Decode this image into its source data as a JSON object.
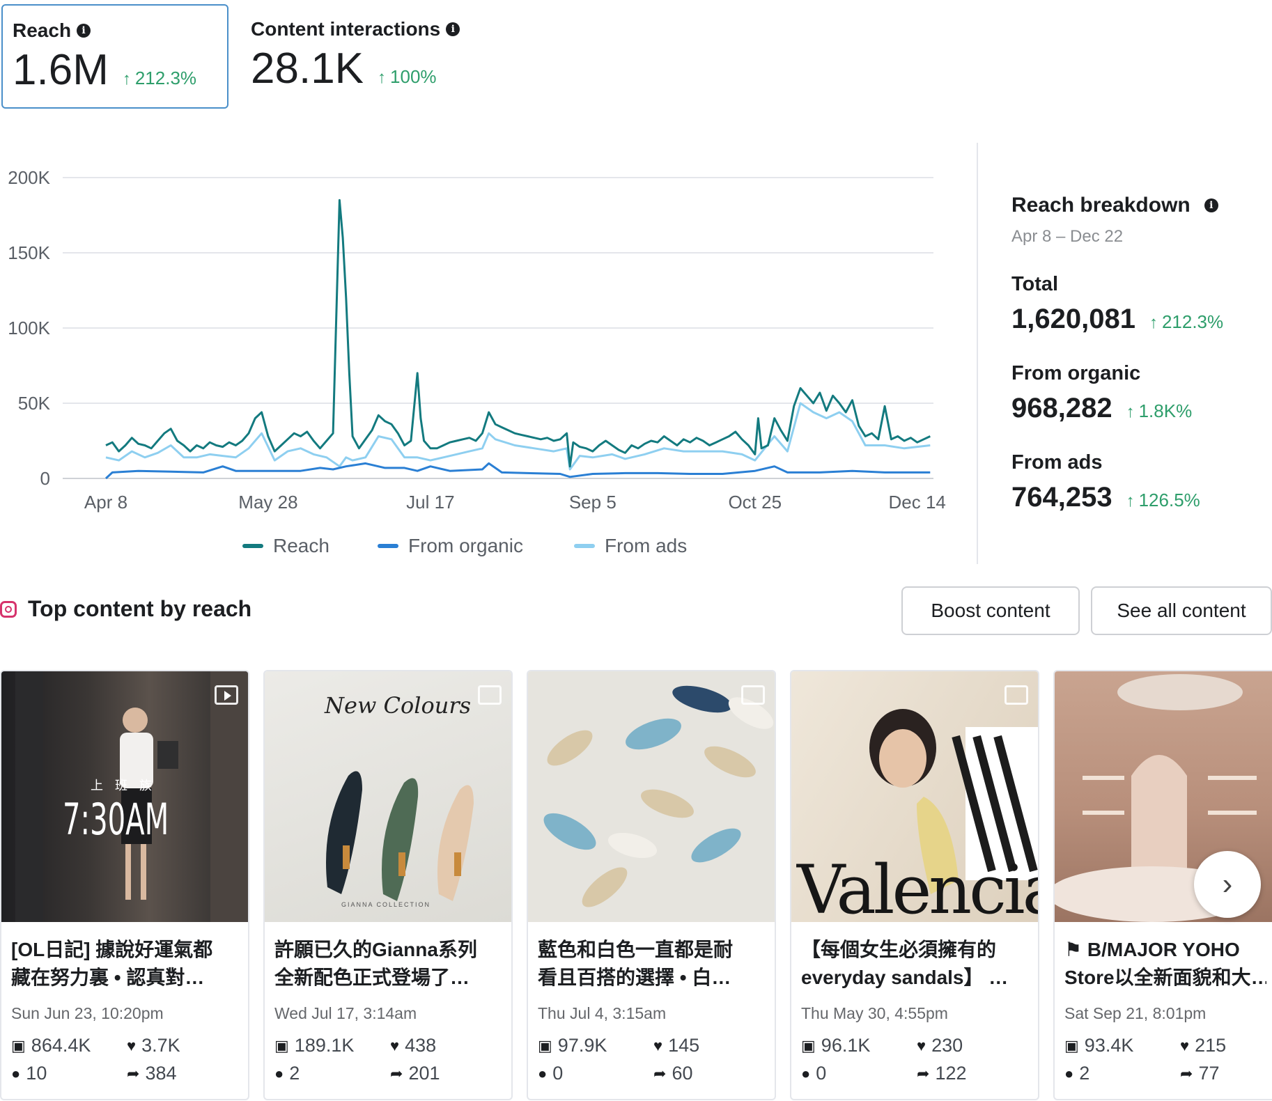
{
  "metrics": {
    "reach": {
      "label": "Reach",
      "value": "1.6M",
      "change": "212.3%"
    },
    "interactions": {
      "label": "Content interactions",
      "value": "28.1K",
      "change": "100%"
    }
  },
  "chart_data": {
    "type": "line",
    "x_ticks": [
      "Apr 8",
      "May 28",
      "Jul 17",
      "Sep 5",
      "Oct 25",
      "Dec 14"
    ],
    "y_ticks": [
      "200K",
      "150K",
      "100K",
      "50K",
      "0"
    ],
    "ylim": [
      0,
      200000
    ],
    "grid": true,
    "legend_position": "bottom",
    "x_range_days": 255,
    "series": [
      {
        "name": "Reach",
        "color": "#137a7f",
        "values": [
          [
            0,
            22000
          ],
          [
            2,
            24000
          ],
          [
            4,
            18000
          ],
          [
            6,
            22000
          ],
          [
            8,
            27000
          ],
          [
            10,
            23000
          ],
          [
            12,
            22000
          ],
          [
            14,
            20000
          ],
          [
            16,
            25000
          ],
          [
            18,
            30000
          ],
          [
            20,
            33000
          ],
          [
            22,
            25000
          ],
          [
            24,
            22000
          ],
          [
            26,
            18000
          ],
          [
            28,
            22000
          ],
          [
            30,
            20000
          ],
          [
            32,
            24000
          ],
          [
            34,
            22000
          ],
          [
            36,
            21000
          ],
          [
            38,
            24000
          ],
          [
            40,
            22000
          ],
          [
            42,
            25000
          ],
          [
            44,
            30000
          ],
          [
            46,
            40000
          ],
          [
            48,
            44000
          ],
          [
            50,
            28000
          ],
          [
            52,
            18000
          ],
          [
            54,
            22000
          ],
          [
            56,
            26000
          ],
          [
            58,
            30000
          ],
          [
            60,
            28000
          ],
          [
            62,
            31000
          ],
          [
            64,
            25000
          ],
          [
            66,
            20000
          ],
          [
            68,
            25000
          ],
          [
            70,
            30000
          ],
          [
            72,
            185000
          ],
          [
            73,
            160000
          ],
          [
            74,
            120000
          ],
          [
            75,
            70000
          ],
          [
            76,
            28000
          ],
          [
            78,
            20000
          ],
          [
            80,
            26000
          ],
          [
            82,
            32000
          ],
          [
            84,
            42000
          ],
          [
            86,
            38000
          ],
          [
            88,
            36000
          ],
          [
            90,
            30000
          ],
          [
            92,
            22000
          ],
          [
            94,
            25000
          ],
          [
            96,
            70000
          ],
          [
            97,
            40000
          ],
          [
            98,
            25000
          ],
          [
            100,
            20000
          ],
          [
            102,
            20000
          ],
          [
            104,
            22000
          ],
          [
            106,
            24000
          ],
          [
            108,
            25000
          ],
          [
            110,
            26000
          ],
          [
            112,
            27000
          ],
          [
            114,
            25000
          ],
          [
            116,
            30000
          ],
          [
            118,
            44000
          ],
          [
            120,
            36000
          ],
          [
            122,
            34000
          ],
          [
            124,
            32000
          ],
          [
            126,
            30000
          ],
          [
            128,
            29000
          ],
          [
            130,
            28000
          ],
          [
            132,
            27000
          ],
          [
            134,
            26000
          ],
          [
            136,
            27000
          ],
          [
            138,
            25000
          ],
          [
            140,
            26000
          ],
          [
            142,
            30000
          ],
          [
            143,
            8000
          ],
          [
            144,
            24000
          ],
          [
            146,
            21000
          ],
          [
            148,
            20000
          ],
          [
            150,
            18000
          ],
          [
            152,
            22000
          ],
          [
            154,
            25000
          ],
          [
            156,
            22000
          ],
          [
            158,
            19000
          ],
          [
            160,
            17000
          ],
          [
            162,
            22000
          ],
          [
            164,
            20000
          ],
          [
            166,
            23000
          ],
          [
            168,
            25000
          ],
          [
            170,
            24000
          ],
          [
            172,
            28000
          ],
          [
            174,
            25000
          ],
          [
            176,
            22000
          ],
          [
            178,
            26000
          ],
          [
            180,
            24000
          ],
          [
            182,
            27000
          ],
          [
            184,
            25000
          ],
          [
            186,
            22000
          ],
          [
            188,
            24000
          ],
          [
            190,
            26000
          ],
          [
            192,
            28000
          ],
          [
            194,
            31000
          ],
          [
            196,
            26000
          ],
          [
            198,
            22000
          ],
          [
            200,
            16000
          ],
          [
            201,
            40000
          ],
          [
            202,
            20000
          ],
          [
            204,
            22000
          ],
          [
            206,
            40000
          ],
          [
            208,
            32000
          ],
          [
            210,
            25000
          ],
          [
            212,
            48000
          ],
          [
            214,
            60000
          ],
          [
            216,
            55000
          ],
          [
            218,
            50000
          ],
          [
            220,
            57000
          ],
          [
            222,
            45000
          ],
          [
            224,
            55000
          ],
          [
            226,
            50000
          ],
          [
            228,
            44000
          ],
          [
            230,
            52000
          ],
          [
            232,
            35000
          ],
          [
            234,
            28000
          ],
          [
            236,
            30000
          ],
          [
            238,
            26000
          ],
          [
            240,
            48000
          ],
          [
            242,
            26000
          ],
          [
            244,
            28000
          ],
          [
            246,
            25000
          ],
          [
            248,
            27000
          ],
          [
            250,
            24000
          ],
          [
            252,
            26000
          ],
          [
            254,
            28000
          ]
        ]
      },
      {
        "name": "From organic",
        "color": "#2a7fd4",
        "values": [
          [
            0,
            0
          ],
          [
            2,
            4000
          ],
          [
            10,
            5000
          ],
          [
            20,
            4500
          ],
          [
            30,
            4000
          ],
          [
            36,
            8000
          ],
          [
            40,
            5000
          ],
          [
            50,
            5000
          ],
          [
            60,
            5000
          ],
          [
            66,
            7000
          ],
          [
            70,
            6000
          ],
          [
            74,
            8000
          ],
          [
            80,
            10000
          ],
          [
            86,
            7000
          ],
          [
            92,
            7000
          ],
          [
            96,
            5000
          ],
          [
            100,
            8000
          ],
          [
            106,
            5000
          ],
          [
            116,
            6000
          ],
          [
            118,
            10000
          ],
          [
            122,
            4000
          ],
          [
            130,
            3500
          ],
          [
            140,
            3000
          ],
          [
            143,
            1000
          ],
          [
            150,
            3000
          ],
          [
            160,
            3500
          ],
          [
            170,
            3500
          ],
          [
            180,
            3000
          ],
          [
            190,
            3000
          ],
          [
            200,
            5000
          ],
          [
            206,
            8000
          ],
          [
            210,
            4000
          ],
          [
            220,
            4000
          ],
          [
            230,
            5000
          ],
          [
            240,
            4000
          ],
          [
            254,
            4000
          ]
        ]
      },
      {
        "name": "From ads",
        "color": "#8ecff0",
        "values": [
          [
            0,
            14000
          ],
          [
            4,
            12000
          ],
          [
            8,
            18000
          ],
          [
            12,
            14000
          ],
          [
            16,
            17000
          ],
          [
            20,
            22000
          ],
          [
            24,
            14000
          ],
          [
            28,
            14000
          ],
          [
            32,
            16000
          ],
          [
            36,
            15000
          ],
          [
            40,
            14000
          ],
          [
            44,
            20000
          ],
          [
            48,
            30000
          ],
          [
            52,
            12000
          ],
          [
            56,
            18000
          ],
          [
            60,
            20000
          ],
          [
            64,
            16000
          ],
          [
            68,
            14000
          ],
          [
            72,
            8000
          ],
          [
            74,
            14000
          ],
          [
            76,
            12000
          ],
          [
            80,
            14000
          ],
          [
            84,
            28000
          ],
          [
            88,
            26000
          ],
          [
            92,
            14000
          ],
          [
            96,
            14000
          ],
          [
            100,
            12000
          ],
          [
            104,
            14000
          ],
          [
            108,
            16000
          ],
          [
            112,
            18000
          ],
          [
            116,
            20000
          ],
          [
            118,
            30000
          ],
          [
            120,
            26000
          ],
          [
            126,
            22000
          ],
          [
            132,
            20000
          ],
          [
            138,
            18000
          ],
          [
            142,
            20000
          ],
          [
            143,
            6000
          ],
          [
            146,
            15000
          ],
          [
            150,
            14000
          ],
          [
            156,
            16000
          ],
          [
            160,
            13000
          ],
          [
            166,
            16000
          ],
          [
            172,
            20000
          ],
          [
            178,
            18000
          ],
          [
            184,
            18000
          ],
          [
            190,
            18000
          ],
          [
            196,
            16000
          ],
          [
            200,
            12000
          ],
          [
            206,
            28000
          ],
          [
            210,
            18000
          ],
          [
            214,
            50000
          ],
          [
            218,
            44000
          ],
          [
            222,
            40000
          ],
          [
            226,
            44000
          ],
          [
            230,
            38000
          ],
          [
            234,
            22000
          ],
          [
            240,
            22000
          ],
          [
            246,
            20000
          ],
          [
            254,
            22000
          ]
        ]
      }
    ]
  },
  "breakdown": {
    "title": "Reach breakdown",
    "date_range": "Apr 8 – Dec 22",
    "total": {
      "label": "Total",
      "value": "1,620,081",
      "change": "212.3%"
    },
    "organic": {
      "label": "From organic",
      "value": "968,282",
      "change": "1.8K%"
    },
    "ads": {
      "label": "From ads",
      "value": "764,253",
      "change": "126.5%"
    }
  },
  "top_content": {
    "title": "Top content by reach",
    "boost_label": "Boost content",
    "see_all_label": "See all content",
    "cards": [
      {
        "line1": "[OL日記] 據說好運氣都",
        "line2": "藏在努力裏 • 認真對…",
        "date": "Sun Jun 23, 10:20pm",
        "views": "864.4K",
        "likes": "3.7K",
        "comments": "10",
        "shares": "384",
        "type": "video",
        "overlay_small": "上 班 族",
        "overlay_big": "7:30AM"
      },
      {
        "line1": "許願已久的Gianna系列",
        "line2": "全新配色正式登場了…",
        "date": "Wed Jul 17, 3:14am",
        "views": "189.1K",
        "likes": "438",
        "comments": "2",
        "shares": "201",
        "type": "carousel",
        "overlay_big": "New Colours",
        "overlay_small": "GIANNA COLLECTION"
      },
      {
        "line1": "藍色和白色一直都是耐",
        "line2": "看且百搭的選擇 • 白…",
        "date": "Thu Jul 4, 3:15am",
        "views": "97.9K",
        "likes": "145",
        "comments": "0",
        "shares": "60",
        "type": "carousel"
      },
      {
        "line1": "【每個女生必須擁有的",
        "line2": "everyday sandals】 …",
        "date": "Thu May 30, 4:55pm",
        "views": "96.1K",
        "likes": "230",
        "comments": "0",
        "shares": "122",
        "type": "carousel",
        "overlay_big": "Valencia"
      },
      {
        "line1": "⚑ B/MAJOR YOHO",
        "line2": "Store以全新面貌和大…",
        "date": "Sat Sep 21, 8:01pm",
        "views": "93.4K",
        "likes": "215",
        "comments": "2",
        "shares": "77",
        "type": "carousel"
      }
    ]
  },
  "icons": {
    "views": "image-icon",
    "likes": "heart-icon",
    "comments": "comment-icon",
    "shares": "share-arrow-icon",
    "next": "chevron-right-icon"
  }
}
